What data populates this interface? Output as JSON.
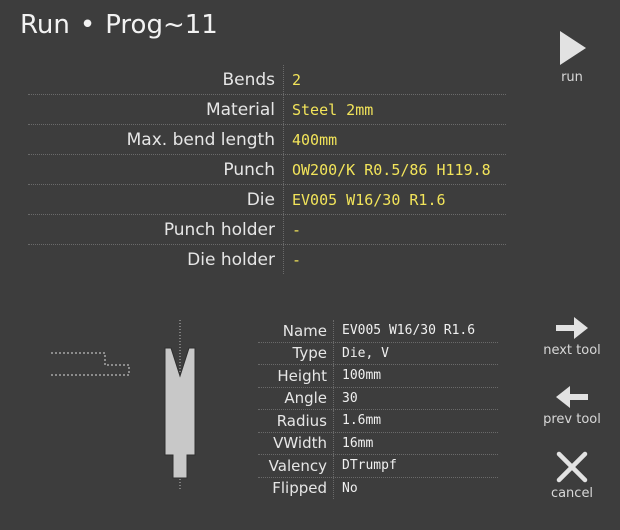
{
  "header": {
    "app": "Run",
    "separator": "•",
    "program": "Prog~11"
  },
  "buttons": {
    "run": "run",
    "next_tool": "next tool",
    "prev_tool": "prev tool",
    "cancel": "cancel"
  },
  "info": {
    "rows": [
      {
        "label": "Bends",
        "value": "2"
      },
      {
        "label": "Material",
        "value": "Steel 2mm"
      },
      {
        "label": "Max. bend length",
        "value": "400mm"
      },
      {
        "label": "Punch",
        "value": "OW200/K R0.5/86 H119.8"
      },
      {
        "label": "Die",
        "value": "EV005 W16/30 R1.6"
      },
      {
        "label": "Punch holder",
        "value": "-"
      },
      {
        "label": "Die holder",
        "value": "-"
      }
    ]
  },
  "tool": {
    "rows": [
      {
        "label": "Name",
        "value": "EV005 W16/30 R1.6"
      },
      {
        "label": "Type",
        "value": "Die, V"
      },
      {
        "label": "Height",
        "value": "100mm"
      },
      {
        "label": "Angle",
        "value": "30"
      },
      {
        "label": "Radius",
        "value": "1.6mm"
      },
      {
        "label": "VWidth",
        "value": "16mm"
      },
      {
        "label": "Valency",
        "value": "DTrumpf"
      },
      {
        "label": "Flipped",
        "value": "No"
      }
    ]
  },
  "icons": {
    "run": "play-icon",
    "next": "arrow-right-icon",
    "prev": "arrow-left-icon",
    "cancel": "close-icon"
  }
}
